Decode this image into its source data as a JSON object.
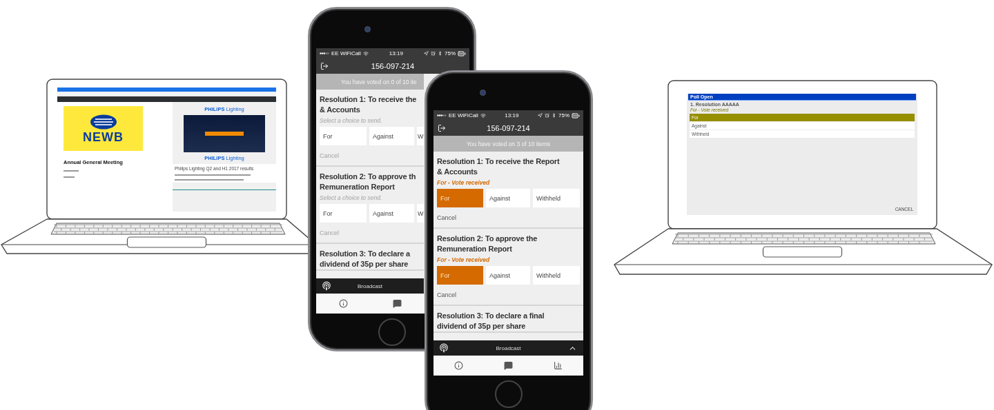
{
  "desktop_laptop": {
    "logo": "NEWB",
    "meeting_title": "Annual General Meeting",
    "webcast_brand": "**PHILIPS** Lighting",
    "video_brand": "**PHILIPS** Lighting",
    "card_title": "Philips Lighting Q2 and H1 2017 results"
  },
  "back_phone": {
    "status_bar": {
      "carrier": "EE WiFiCall",
      "time": "13:19",
      "battery": "75%"
    },
    "meeting_id": "156-097-214",
    "voted_banner": "You have voted on 0 of 10 ite",
    "resolutions": [
      {
        "title_lines": [
          "Resolution 1: To receive the",
          "& Accounts"
        ],
        "note": {
          "kind": "hint",
          "text": "Select a choice to send."
        },
        "options": [
          {
            "label": "For",
            "selected": false
          },
          {
            "label": "Against",
            "selected": false
          },
          {
            "label": "W",
            "selected": false
          }
        ],
        "cancel": {
          "label": "Cancel",
          "disabled": true
        }
      },
      {
        "title_lines": [
          "Resolution 2: To approve th",
          "Remuneration Report"
        ],
        "note": {
          "kind": "hint",
          "text": "Select a choice to send."
        },
        "options": [
          {
            "label": "For",
            "selected": false
          },
          {
            "label": "Against",
            "selected": false
          },
          {
            "label": "W",
            "selected": false
          }
        ],
        "cancel": {
          "label": "Cancel",
          "disabled": true
        }
      },
      {
        "title_lines": [
          "Resolution 3: To declare a",
          "dividend of 35p per share"
        ]
      }
    ],
    "broadcast": "Broadcast"
  },
  "front_phone": {
    "status_bar": {
      "carrier": "EE WiFiCall",
      "time": "13:19",
      "battery": "75%"
    },
    "meeting_id": "156-097-214",
    "voted_banner": "You have voted on 3 of 10 items",
    "resolutions": [
      {
        "title_lines": [
          "Resolution 1: To receive the Report",
          "& Accounts"
        ],
        "note": {
          "kind": "received",
          "text": "For - Vote received"
        },
        "options": [
          {
            "label": "For",
            "selected": true
          },
          {
            "label": "Against",
            "selected": false
          },
          {
            "label": "Withheld",
            "selected": false
          }
        ],
        "cancel": {
          "label": "Cancel",
          "disabled": false
        }
      },
      {
        "title_lines": [
          "Resolution 2: To approve the",
          "Remuneration Report"
        ],
        "note": {
          "kind": "received",
          "text": "For - Vote received"
        },
        "options": [
          {
            "label": "For",
            "selected": true
          },
          {
            "label": "Against",
            "selected": false
          },
          {
            "label": "Withheld",
            "selected": false
          }
        ],
        "cancel": {
          "label": "Cancel",
          "disabled": false
        }
      },
      {
        "title_lines": [
          "Resolution 3: To declare a final",
          "dividend of 35p per share"
        ]
      }
    ],
    "broadcast": "Broadcast"
  },
  "poll_laptop": {
    "title": "Poll Open",
    "question": "1. Resolution AAAAA",
    "status": "For - Vote received",
    "options": [
      {
        "label": "For",
        "selected": true
      },
      {
        "label": "Against",
        "selected": false
      },
      {
        "label": "Withheld",
        "selected": false
      }
    ],
    "cancel": "CANCEL"
  }
}
